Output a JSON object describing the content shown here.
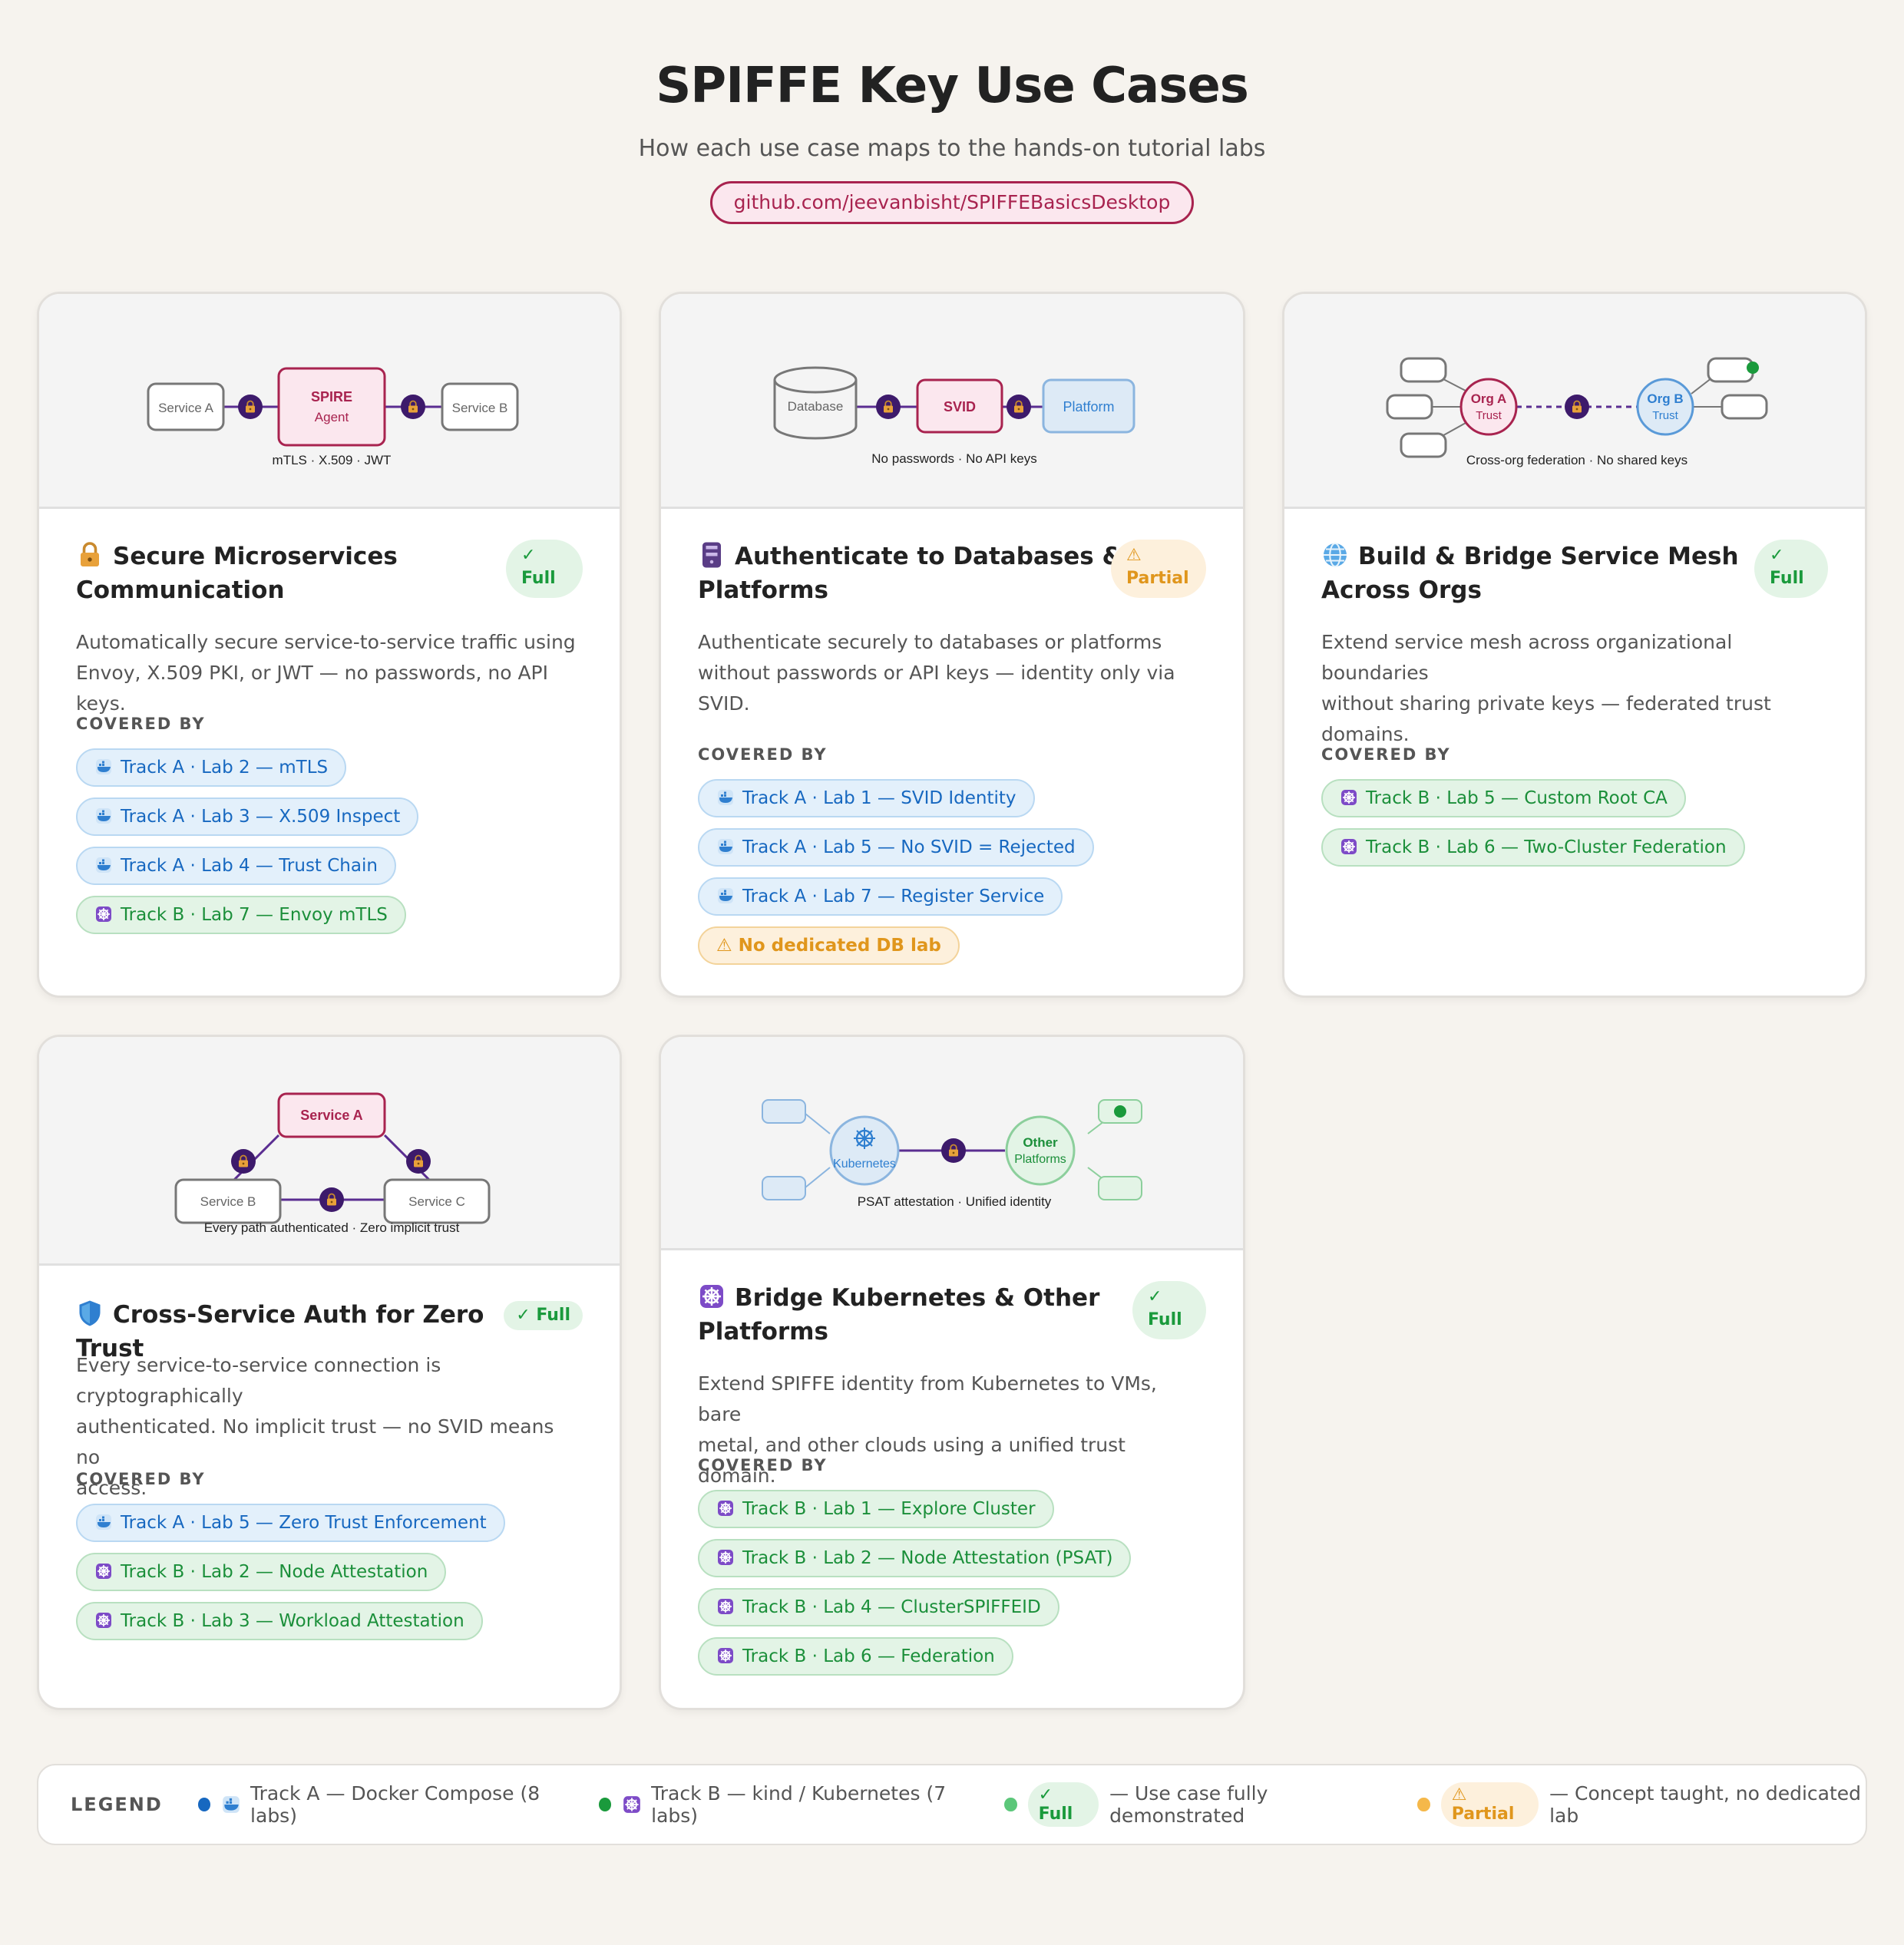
{
  "header": {
    "title": "SPIFFE Key Use Cases",
    "subtitle": "How each use case maps to the hands-on tutorial labs",
    "repo": "github.com/jeevanbisht/SPIFFEBasicsDesktop"
  },
  "covered_label": "COVERED BY",
  "cards": [
    {
      "icon": "lock-icon",
      "title_line1": "Secure Microservices",
      "title_line2": "Communication",
      "badge": {
        "check": "✓",
        "label": "Full",
        "type": "full"
      },
      "desc_lines": [
        "Automatically secure service-to-service traffic using",
        "Envoy, X.509 PKI, or JWT — no passwords, no API keys."
      ],
      "figure": {
        "service_a": "Service A",
        "spire": "SPIRE",
        "agent": "Agent",
        "service_b": "Service B",
        "caption": "mTLS · X.509 · JWT"
      },
      "labs": [
        {
          "track": "a",
          "label": "Track A · Lab 2 — mTLS"
        },
        {
          "track": "a",
          "label": "Track A · Lab 3 — X.509 Inspect"
        },
        {
          "track": "a",
          "label": "Track A · Lab 4 — Trust Chain"
        },
        {
          "track": "b",
          "label": "Track B · Lab 7 — Envoy mTLS"
        }
      ]
    },
    {
      "icon": "server-icon",
      "title_line1": "Authenticate to Databases &",
      "title_line2": "Platforms",
      "badge": {
        "check": "⚠",
        "label": "Partial",
        "type": "partial"
      },
      "desc_lines": [
        "Authenticate securely to databases or platforms",
        "without passwords or API keys — identity only via",
        "SVID."
      ],
      "figure": {
        "database": "Database",
        "svid": "SVID",
        "platform": "Platform",
        "caption": "No passwords · No API keys"
      },
      "labs": [
        {
          "track": "a",
          "label": "Track A · Lab 1 — SVID Identity"
        },
        {
          "track": "a",
          "label": "Track A · Lab 5 — No SVID = Rejected"
        },
        {
          "track": "a",
          "label": "Track A · Lab 7 — Register Service"
        },
        {
          "track": "w",
          "label": "⚠ No dedicated DB lab"
        }
      ]
    },
    {
      "icon": "globe-icon",
      "title_line1": "Build & Bridge Service Mesh",
      "title_line2": "Across Orgs",
      "badge": {
        "check": "✓",
        "label": "Full",
        "type": "full"
      },
      "desc_lines": [
        "Extend service mesh across organizational boundaries",
        "without sharing private keys — federated trust",
        "domains."
      ],
      "figure": {
        "org_a": "Org A",
        "org_b": "Org B",
        "trust": "Trust",
        "caption": "Cross-org federation · No shared keys"
      },
      "labs": [
        {
          "track": "b",
          "label": "Track B · Lab 5 — Custom Root CA"
        },
        {
          "track": "b",
          "label": "Track B · Lab 6 — Two-Cluster Federation"
        }
      ]
    },
    {
      "icon": "shield-icon",
      "title_line1": "Cross-Service Auth for Zero Trust",
      "title_line2": "",
      "badge": {
        "check": "✓",
        "label": "Full",
        "type": "full"
      },
      "desc_lines": [
        "Every service-to-service connection is cryptographically",
        "authenticated. No implicit trust — no SVID means no",
        "access."
      ],
      "figure": {
        "service_a": "Service A",
        "service_b": "Service B",
        "service_c": "Service C",
        "caption": "Every path authenticated · Zero implicit trust"
      },
      "labs": [
        {
          "track": "a",
          "label": "Track A · Lab 5 — Zero Trust Enforcement"
        },
        {
          "track": "b",
          "label": "Track B · Lab 2 — Node Attestation"
        },
        {
          "track": "b",
          "label": "Track B · Lab 3 — Workload Attestation"
        }
      ]
    },
    {
      "icon": "helm-icon",
      "title_line1": "Bridge Kubernetes & Other",
      "title_line2": "Platforms",
      "badge": {
        "check": "✓",
        "label": "Full",
        "type": "full"
      },
      "desc_lines": [
        "Extend SPIFFE identity from Kubernetes to VMs, bare",
        "metal, and other clouds using a unified trust domain."
      ],
      "figure": {
        "kubernetes": "Kubernetes",
        "other": "Other",
        "platforms": "Platforms",
        "caption": "PSAT attestation · Unified identity"
      },
      "labs": [
        {
          "track": "b",
          "label": "Track B · Lab 1 — Explore Cluster"
        },
        {
          "track": "b",
          "label": "Track B · Lab 2 — Node Attestation (PSAT)"
        },
        {
          "track": "b",
          "label": "Track B · Lab 4 — ClusterSPIFFEID"
        },
        {
          "track": "b",
          "label": "Track B · Lab 6 — Federation"
        }
      ]
    }
  ],
  "legend": {
    "title": "LEGEND",
    "track_a": "Track A — Docker Compose (8 labs)",
    "track_b": "Track B — kind / Kubernetes (7 labs)",
    "full_badge": "✓ Full",
    "full_desc": "— Use case fully demonstrated",
    "partial_badge": "⚠ Partial",
    "partial_desc": "— Concept taught, no dedicated lab",
    "colors": {
      "track_a": "#1768c0",
      "track_b": "#1a9a3c",
      "full": "#5cc77a",
      "partial": "#f5b84a"
    }
  }
}
